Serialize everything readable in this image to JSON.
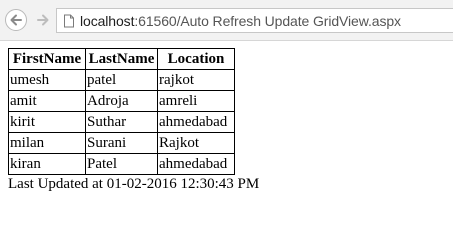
{
  "browser": {
    "url_host": "localhost",
    "url_rest": ":61560/Auto Refresh Update GridView.aspx",
    "back_icon": "arrow-left-icon",
    "forward_icon": "arrow-right-icon",
    "page_icon": "page-icon"
  },
  "grid": {
    "headers": [
      "FirstName",
      "LastName",
      "Location"
    ],
    "rows": [
      [
        "umesh",
        "patel",
        "rajkot"
      ],
      [
        "amit",
        "Adroja",
        "amreli"
      ],
      [
        "kirit",
        "Suthar",
        "ahmedabad"
      ],
      [
        "milan",
        "Surani",
        "Rajkot"
      ],
      [
        "kiran",
        "Patel",
        "ahmedabad"
      ]
    ]
  },
  "status": {
    "last_updated": "Last Updated at 01-02-2016 12:30:43 PM"
  }
}
